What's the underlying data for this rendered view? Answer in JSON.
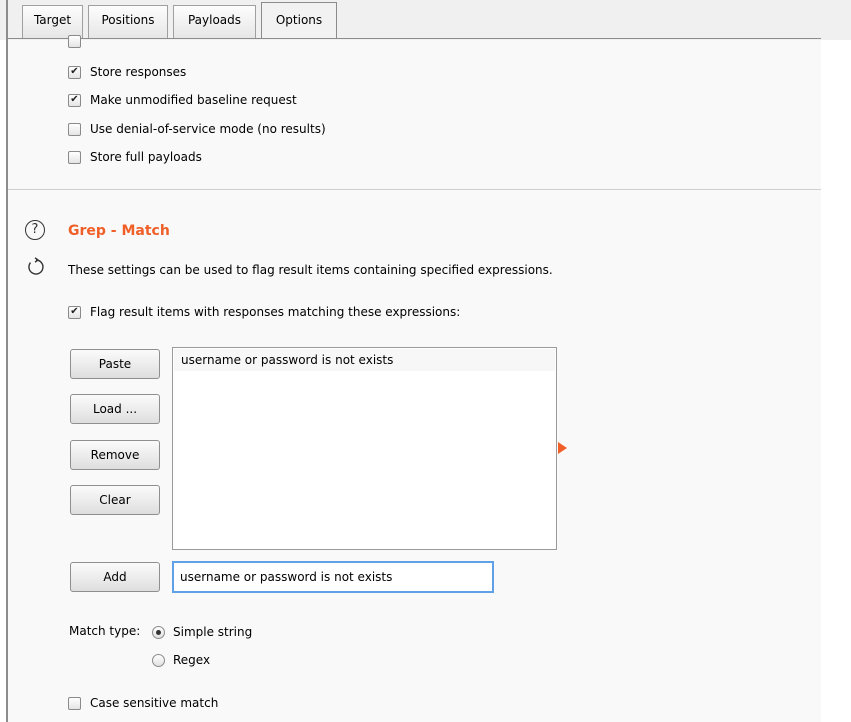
{
  "tabs": [
    {
      "label": "Target",
      "active": false
    },
    {
      "label": "Positions",
      "active": false
    },
    {
      "label": "Payloads",
      "active": false
    },
    {
      "label": "Options",
      "active": true
    }
  ],
  "request_options": {
    "items": [
      {
        "label": "Store responses",
        "checked": true
      },
      {
        "label": "Make unmodified baseline request",
        "checked": true
      },
      {
        "label": "Use denial-of-service mode (no results)",
        "checked": false
      },
      {
        "label": "Store full payloads",
        "checked": false
      }
    ]
  },
  "grep_match": {
    "title": "Grep - Match",
    "description": "These settings can be used to flag result items containing specified expressions.",
    "flag_label": "Flag result items with responses matching these expressions:",
    "flag_checked": true,
    "buttons": {
      "paste": "Paste",
      "load": "Load ...",
      "remove": "Remove",
      "clear": "Clear",
      "add": "Add"
    },
    "list_items": [
      "username or password is not exists"
    ],
    "input_value": "username or password is not exists",
    "match_type_label": "Match type:",
    "match_options": [
      {
        "label": "Simple string",
        "selected": true
      },
      {
        "label": "Regex",
        "selected": false
      }
    ],
    "case_sensitive_label": "Case sensitive match",
    "case_sensitive_checked": false
  },
  "icons": {
    "help": "help-icon",
    "refresh": "refresh-icon",
    "arrow": "arrow-right-icon"
  },
  "colors": {
    "accent": "#f05f28",
    "focus": "#5fa0e6"
  }
}
